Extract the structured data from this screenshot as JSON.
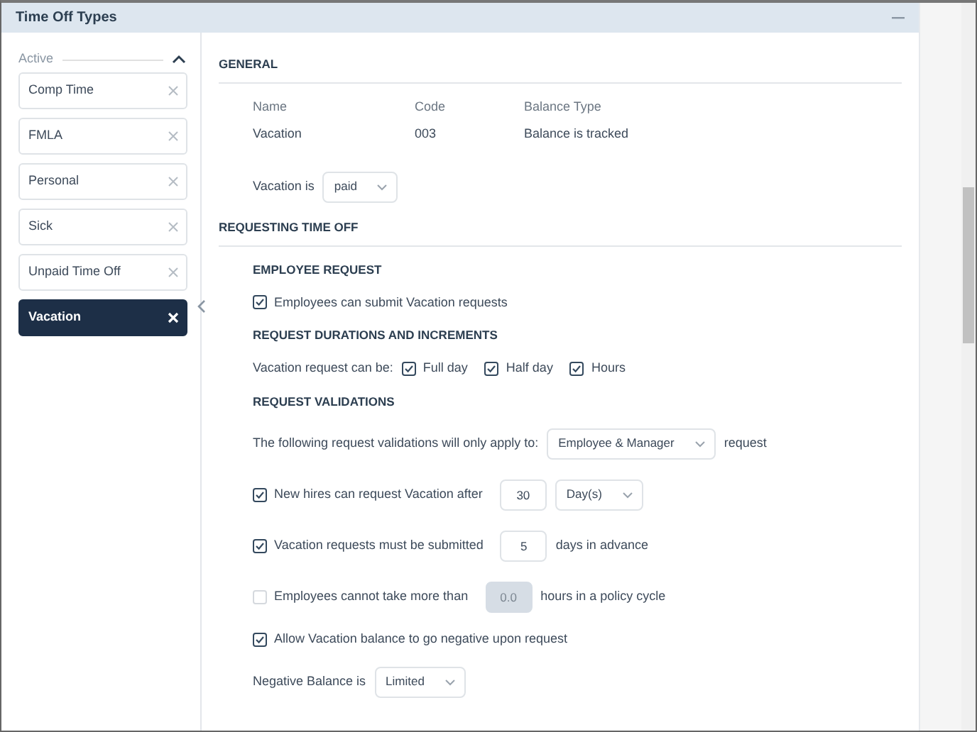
{
  "panel": {
    "title": "Time Off Types"
  },
  "sidebar": {
    "group_label": "Active",
    "expanded": true,
    "items": [
      {
        "label": "Comp Time",
        "selected": false
      },
      {
        "label": "FMLA",
        "selected": false
      },
      {
        "label": "Personal",
        "selected": false
      },
      {
        "label": "Sick",
        "selected": false
      },
      {
        "label": "Unpaid Time Off",
        "selected": false
      },
      {
        "label": "Vacation",
        "selected": true
      }
    ]
  },
  "general": {
    "heading": "GENERAL",
    "fields": [
      {
        "label": "Name",
        "value": "Vacation"
      },
      {
        "label": "Code",
        "value": "003"
      },
      {
        "label": "Balance Type",
        "value": "Balance is tracked"
      }
    ],
    "paid_row": {
      "items": [
        {
          "kind": "text",
          "text": "Vacation is"
        },
        {
          "kind": "select",
          "value": "paid"
        }
      ]
    }
  },
  "requesting": {
    "heading": "REQUESTING TIME OFF",
    "sections": [
      {
        "heading": "EMPLOYEE REQUEST",
        "rows": [
          {
            "items": [
              {
                "kind": "check",
                "checked": true,
                "label": "Employees can submit Vacation requests"
              }
            ]
          }
        ]
      },
      {
        "heading": "REQUEST DURATIONS AND INCREMENTS",
        "rows": [
          {
            "items": [
              {
                "kind": "text",
                "text": "Vacation request can be:"
              },
              {
                "kind": "check",
                "checked": true,
                "label": "Full day"
              },
              {
                "kind": "check",
                "checked": true,
                "label": "Half day"
              },
              {
                "kind": "check",
                "checked": true,
                "label": "Hours"
              }
            ]
          }
        ]
      },
      {
        "heading": "REQUEST VALIDATIONS",
        "rows": [
          {
            "items": [
              {
                "kind": "text",
                "text": "The following request validations will only apply to:"
              },
              {
                "kind": "select",
                "value": "Employee & Manager"
              },
              {
                "kind": "text",
                "text": "request"
              }
            ]
          },
          {
            "items": [
              {
                "kind": "check",
                "checked": true,
                "label": "New hires can request Vacation after"
              },
              {
                "kind": "input",
                "value": "30",
                "disabled": false
              },
              {
                "kind": "select",
                "value": "Day(s)"
              }
            ]
          },
          {
            "items": [
              {
                "kind": "check",
                "checked": true,
                "label": "Vacation requests must be submitted"
              },
              {
                "kind": "input",
                "value": "5",
                "disabled": false
              },
              {
                "kind": "text",
                "text": "days in advance"
              }
            ]
          },
          {
            "items": [
              {
                "kind": "check",
                "checked": false,
                "label": "Employees cannot take more than"
              },
              {
                "kind": "input",
                "value": "0.0",
                "disabled": true
              },
              {
                "kind": "text",
                "text": "hours in a policy cycle"
              }
            ]
          },
          {
            "items": [
              {
                "kind": "check",
                "checked": true,
                "label": "Allow Vacation balance to go negative upon request"
              }
            ]
          },
          {
            "items": [
              {
                "kind": "text",
                "text": "Negative Balance is"
              },
              {
                "kind": "select",
                "value": "Limited"
              }
            ]
          }
        ]
      }
    ]
  }
}
